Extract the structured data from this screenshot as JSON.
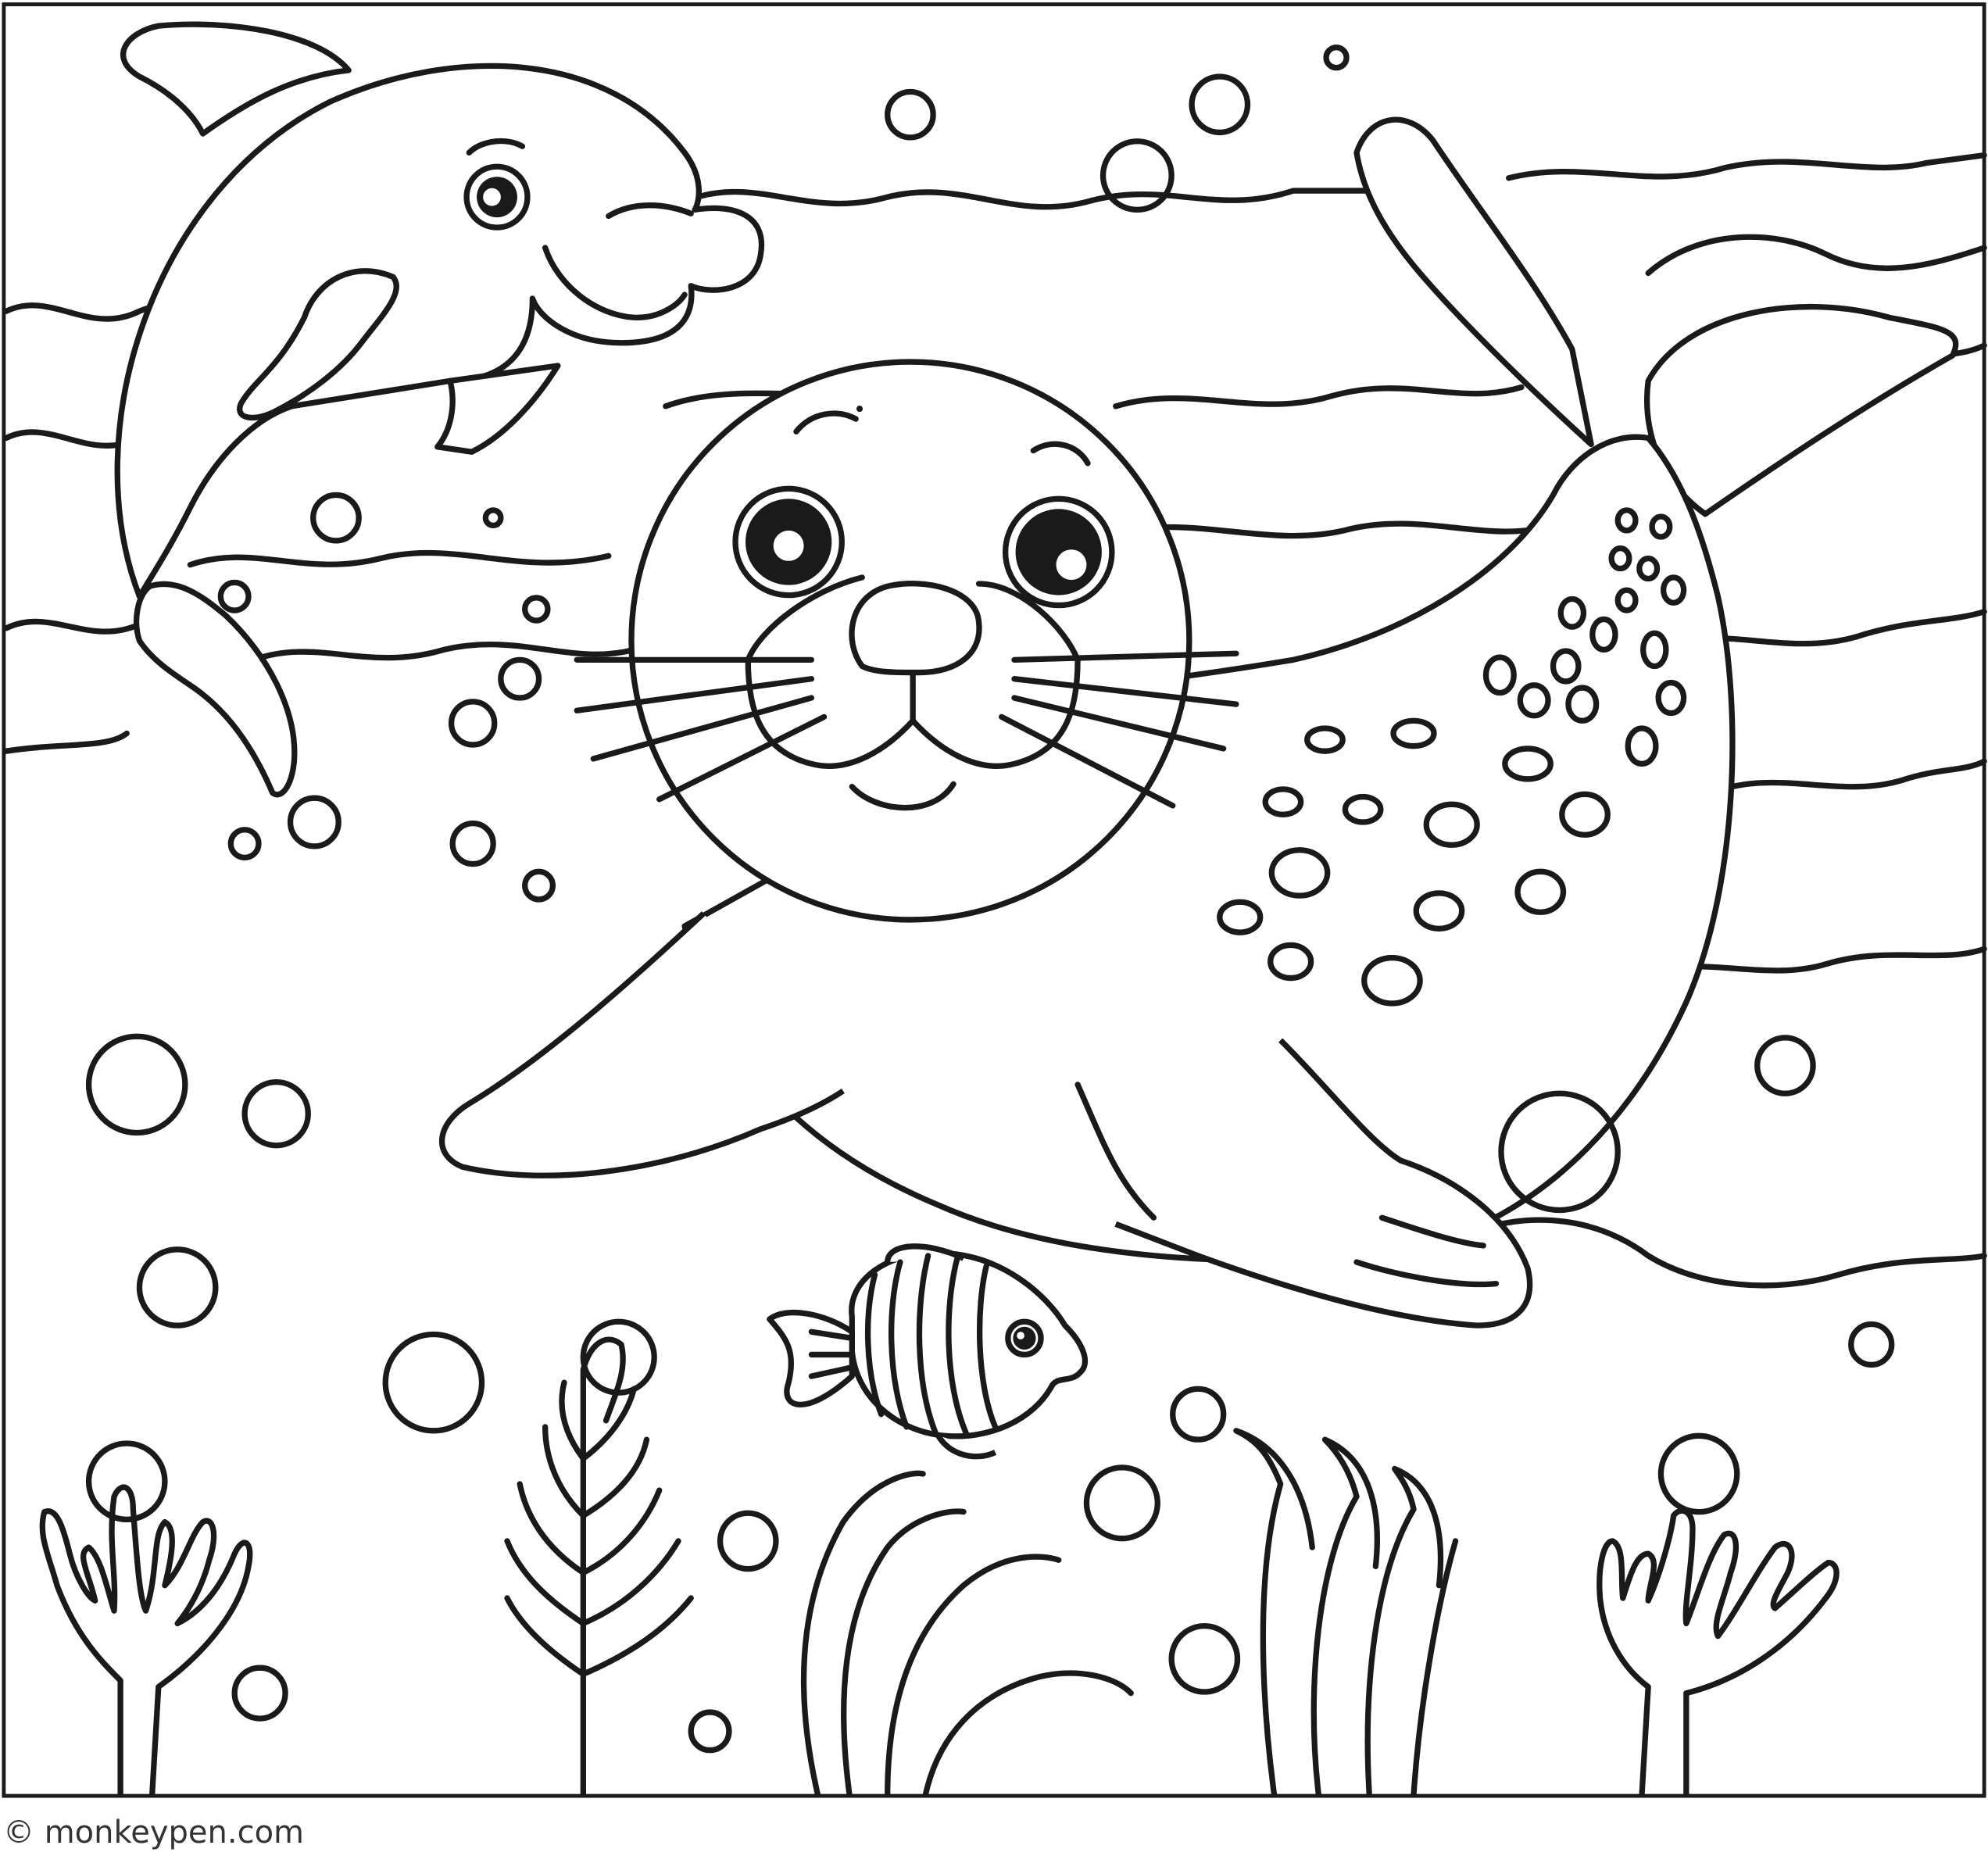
{
  "credit": "© monkeypen.com"
}
